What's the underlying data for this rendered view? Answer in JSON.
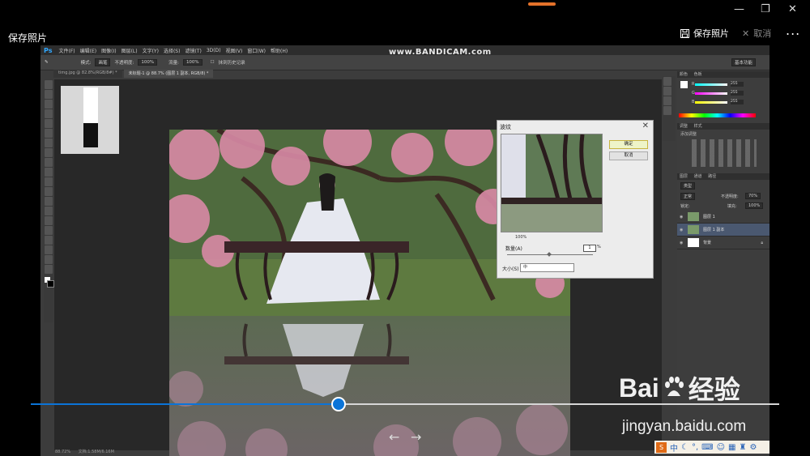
{
  "viewer": {
    "title": "保存照片",
    "save_label": "保存照片",
    "cancel_label": "取消",
    "more_label": "...",
    "window_controls": {
      "minimize": "—",
      "restore": "❐",
      "close": "✕"
    },
    "progress": 0.411,
    "prev_label": "←",
    "next_label": "→",
    "accent": "#0b74d8"
  },
  "recording_watermark": "www.BANDICAM.com",
  "photoshop": {
    "logo": "Ps",
    "menu": [
      "文件(F)",
      "编辑(E)",
      "图像(I)",
      "图层(L)",
      "文字(Y)",
      "选择(S)",
      "滤镜(T)",
      "3D(D)",
      "视图(V)",
      "窗口(W)",
      "帮助(H)"
    ],
    "options": {
      "mode_label": "模式:",
      "mode_value": "画笔",
      "opacity_label": "不透明度:",
      "opacity_value": "100%",
      "flow_label": "流量:",
      "flow_value": "100%",
      "history_label": "抹到历史记录",
      "workspace": "基本功能"
    },
    "tabs": [
      "timg.jpg @ 82.8%(RGB/8#) *",
      "未标题-1 @ 88.7% (图层 1 副本, RGB/8) *"
    ],
    "status": {
      "zoom": "88.72%",
      "doc": "文档:1.58M/6.16M"
    }
  },
  "dialog": {
    "title": "波纹",
    "ok_label": "确定",
    "cancel_label": "取消",
    "zoom": "100%",
    "amount_label": "数量(A)",
    "amount_value": "1",
    "amount_unit": "%",
    "size_label": "大小(S)",
    "size_value": "中"
  },
  "panels": {
    "color_tabs": [
      "颜色",
      "色板"
    ],
    "r_label": "R",
    "g_label": "G",
    "b_label": "B",
    "r_value": "255",
    "g_value": "255",
    "b_value": "255",
    "adjust_tabs": [
      "调整",
      "样式"
    ],
    "adjust_add": "添加调整",
    "layer_tabs": [
      "图层",
      "通道",
      "路径"
    ],
    "blend_mode": "正常",
    "opacity_label": "不透明度:",
    "opacity_value": "70%",
    "lock_label": "锁定:",
    "fill_label": "填充:",
    "fill_value": "100%",
    "kind_label": "类型",
    "layers": [
      {
        "name": "图层 1",
        "selected": false
      },
      {
        "name": "图层 1 副本",
        "selected": true
      },
      {
        "name": "背景",
        "selected": false
      }
    ]
  },
  "branding": {
    "baidu_left": "Bai",
    "baidu_right": "经验",
    "url": "jingyan.baidu.com"
  },
  "ime": {
    "logo": "S",
    "mode": "中"
  }
}
